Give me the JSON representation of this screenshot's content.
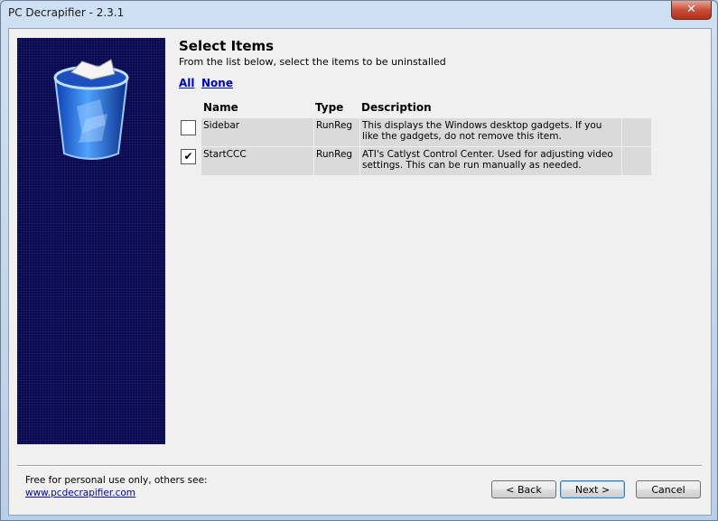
{
  "window": {
    "title": "PC Decrapifier - 2.3.1",
    "close_label": "✕"
  },
  "page": {
    "heading": "Select Items",
    "subheading": "From the list below, select the items to be uninstalled",
    "select_all": "All",
    "select_none": "None"
  },
  "table": {
    "columns": [
      "Name",
      "Type",
      "Description"
    ],
    "rows": [
      {
        "checked": false,
        "name": "Sidebar",
        "type": "RunReg",
        "description": "This displays the Windows desktop gadgets. If you like the gadgets, do not remove this item."
      },
      {
        "checked": true,
        "name": "StartCCC",
        "type": "RunReg",
        "description": "ATI's Catlyst Control Center. Used for adjusting video settings. This can be run manually as needed."
      }
    ]
  },
  "footer": {
    "text": "Free for personal use only, others see:",
    "link": "www.pcdecrapifier.com"
  },
  "buttons": {
    "back": "< Back",
    "next": "Next >",
    "cancel": "Cancel"
  },
  "icons": {
    "sidepanel": "recycle-bin-icon",
    "checkbox_checked": "✔"
  }
}
